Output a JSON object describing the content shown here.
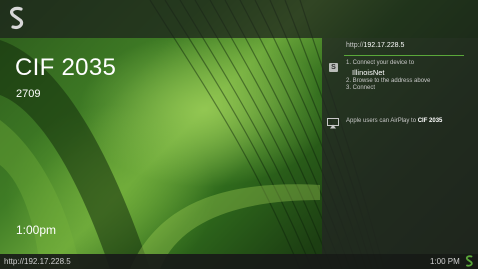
{
  "header": {
    "logo": "solstice-logo"
  },
  "room": {
    "name": "CIF 2035",
    "number": "2709",
    "time": "1:00pm"
  },
  "panel": {
    "url_prefix": "http://",
    "url_host": "192.17.228.5",
    "steps": {
      "step1": "1. Connect your device to",
      "network": "IllinoisNet",
      "step2": "2. Browse to the address above",
      "step3": "3. Connect"
    },
    "airplay_text": "Apple users can AirPlay to",
    "airplay_target": "CIF 2035",
    "step_icon": "S",
    "accent_color": "#5aa83a"
  },
  "footer": {
    "url": "http://192.17.228.5",
    "time": "1:00 PM",
    "logo": "solstice-logo"
  }
}
